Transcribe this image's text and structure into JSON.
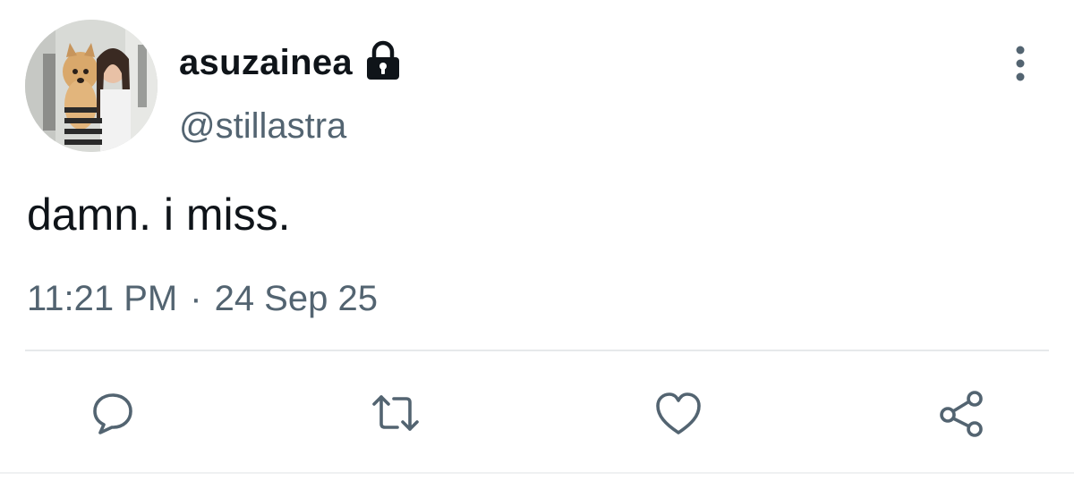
{
  "tweet": {
    "display_name": "asuzainea",
    "handle": "@stillastra",
    "text": "damn. i miss.",
    "time": "11:21 PM",
    "separator": "·",
    "date": "24 Sep 25"
  },
  "icons": {
    "lock": "lock-icon",
    "more": "more-vertical-icon",
    "reply": "reply-icon",
    "retweet": "retweet-icon",
    "like": "heart-icon",
    "share": "share-icon"
  },
  "colors": {
    "text": "#0f1419",
    "secondary": "#536471",
    "divider": "#e6e9eb"
  }
}
